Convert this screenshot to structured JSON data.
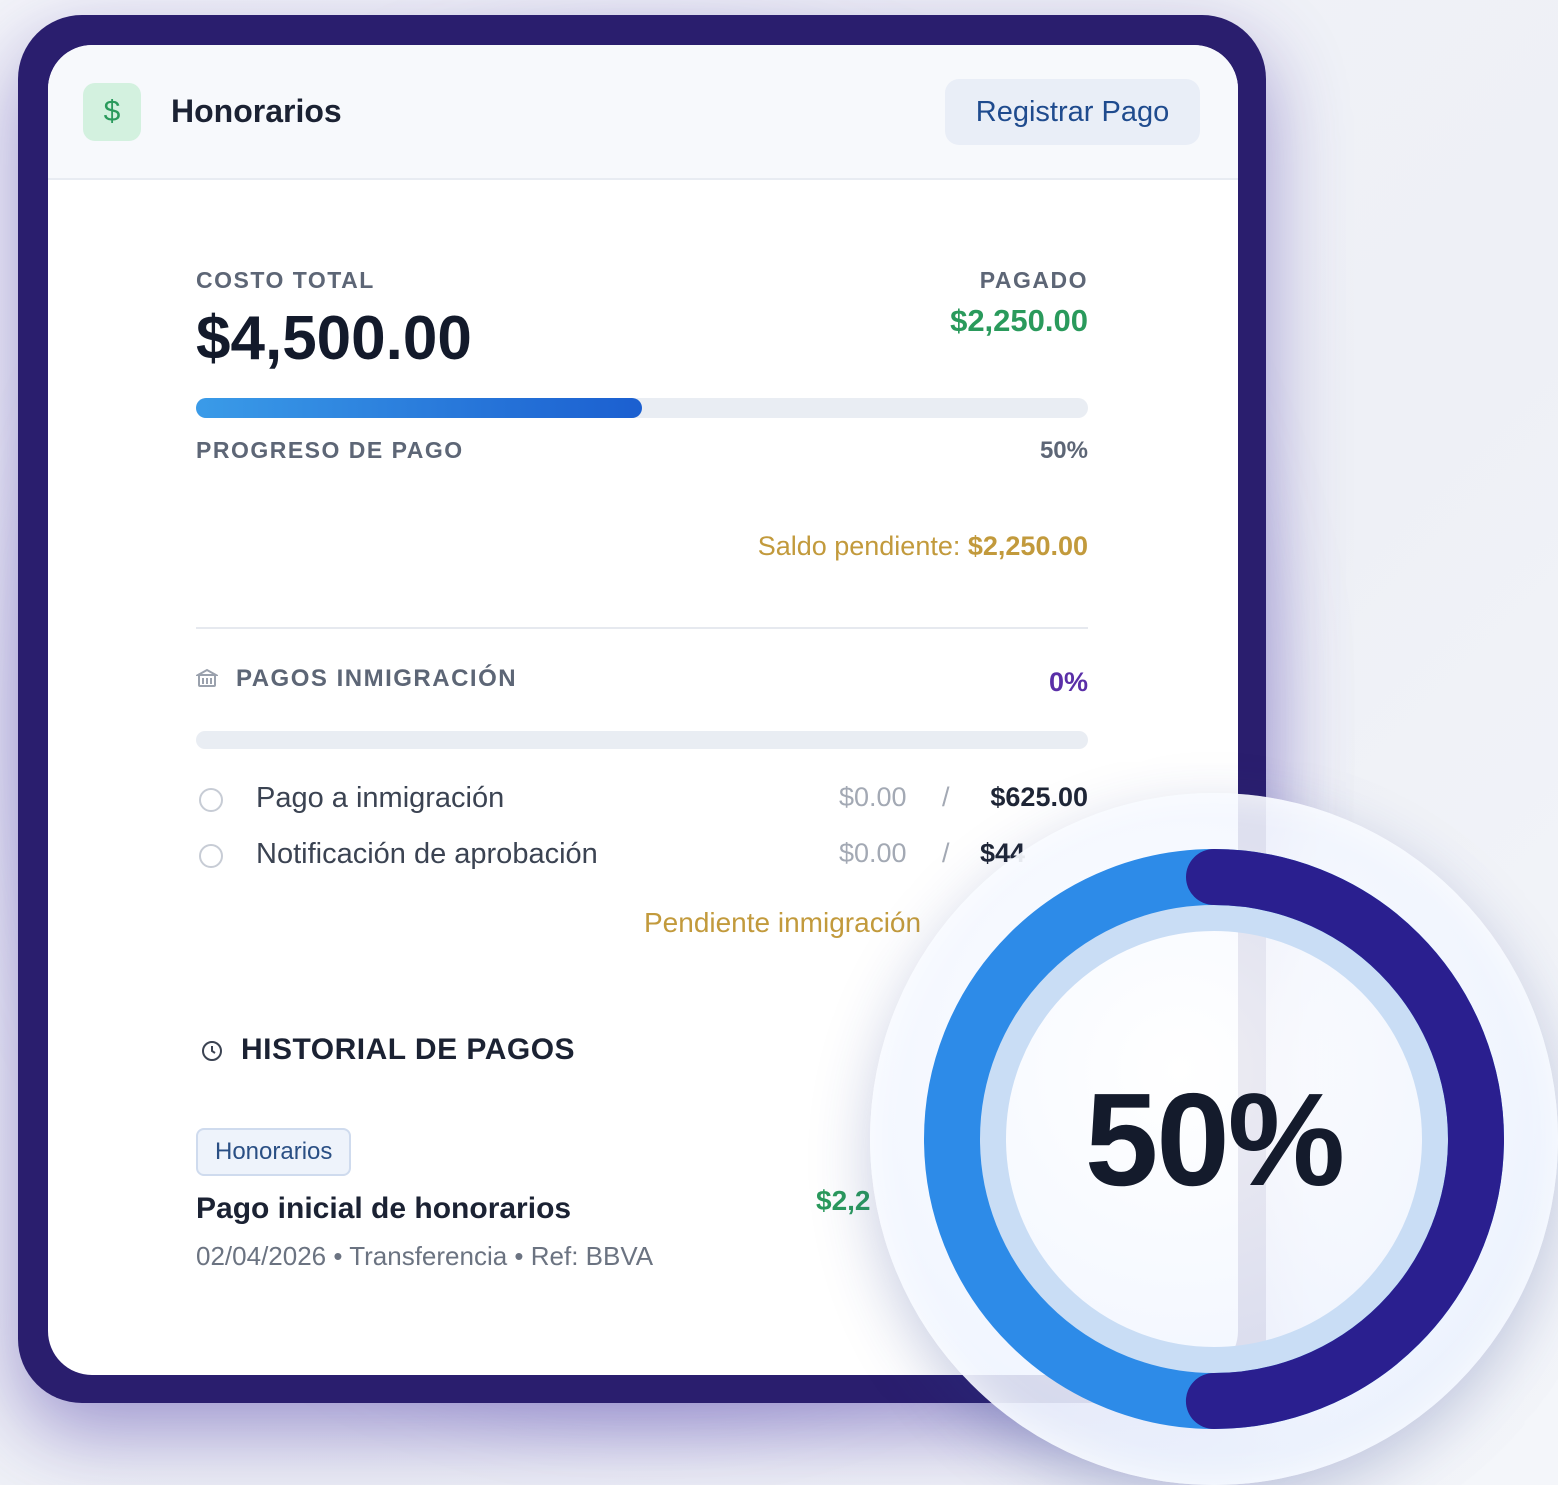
{
  "header": {
    "icon": "dollar-icon",
    "icon_glyph": "$",
    "title": "Honorarios",
    "register_button": "Registrar Pago"
  },
  "summary": {
    "total_label": "COSTO TOTAL",
    "total_value": "$4,500.00",
    "paid_label": "PAGADO",
    "paid_value": "$2,250.00",
    "progress_label": "PROGRESO DE PAGO",
    "progress_text": "50%",
    "progress_fraction": 0.5,
    "balance_label": "Saldo pendiente:",
    "balance_value": "$2,250.00"
  },
  "immigration": {
    "icon": "bank-icon",
    "label": "PAGOS INMIGRACIÓN",
    "percent_text": "0%",
    "progress_fraction": 0,
    "items": [
      {
        "label": "Pago a inmigración",
        "paid": "$0.00",
        "separator": "/",
        "total": "$625.00"
      },
      {
        "label": "Notificación de aprobación",
        "paid": "$0.00",
        "separator": "/",
        "total": "$44"
      }
    ],
    "pending_label": "Pendiente inmigración"
  },
  "history": {
    "icon": "history-icon",
    "title": "HISTORIAL DE PAGOS",
    "entries": [
      {
        "tag": "Honorarios",
        "title": "Pago inicial de honorarios",
        "meta": "02/04/2026 • Transferencia • Ref: BBVA",
        "amount": "$2,2"
      }
    ]
  },
  "donut": {
    "label": "50%",
    "fraction": 0.5,
    "colors": {
      "filled": "#2a1f8f",
      "remaining": "#2d8be8",
      "inner": "#c9ddf5"
    }
  },
  "colors": {
    "frame": "#2a1e6e",
    "accent_green": "#2a9a5c",
    "accent_gold": "#c29a3c",
    "accent_purple": "#5a2fa8",
    "progress_blue": "#1b5fd0"
  }
}
